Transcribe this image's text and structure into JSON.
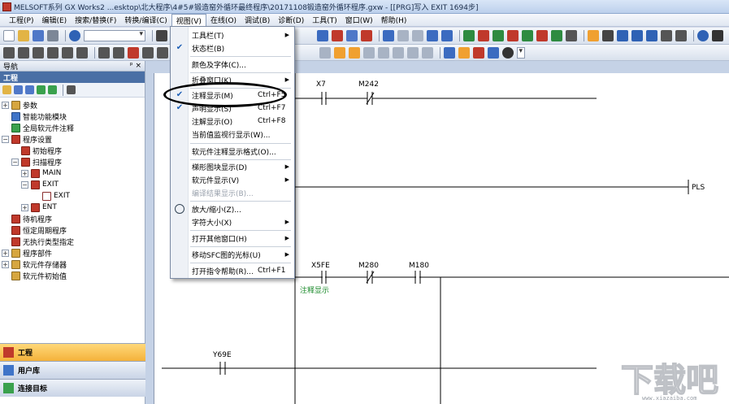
{
  "window": {
    "title": "MELSOFT系列 GX Works2 ...esktop\\北大程序\\4#5#锻造窑外循环最终程序\\20171108锻造窑外循环程序.gxw - [[PRG]写入 EXIT 1694步]"
  },
  "menubar": {
    "items": [
      {
        "label": "工程(P)"
      },
      {
        "label": "编辑(E)"
      },
      {
        "label": "搜索/替换(F)"
      },
      {
        "label": "转换/编译(C)"
      },
      {
        "label": "视图(V)"
      },
      {
        "label": "在线(O)"
      },
      {
        "label": "调试(B)"
      },
      {
        "label": "诊断(D)"
      },
      {
        "label": "工具(T)"
      },
      {
        "label": "窗口(W)"
      },
      {
        "label": "帮助(H)"
      }
    ]
  },
  "navigator": {
    "header": "导航",
    "pin": "ᵖ ×",
    "section": "工程",
    "tree": [
      {
        "label": "参数"
      },
      {
        "label": "智能功能模块"
      },
      {
        "label": "全局软元件注释"
      },
      {
        "label": "程序设置"
      },
      {
        "label": "初始程序"
      },
      {
        "label": "扫描程序"
      },
      {
        "label": "MAIN"
      },
      {
        "label": "EXIT"
      },
      {
        "label": "EXIT"
      },
      {
        "label": "ENT"
      },
      {
        "label": "待机程序"
      },
      {
        "label": "恒定周期程序"
      },
      {
        "label": "无执行类型指定"
      },
      {
        "label": "程序部件"
      },
      {
        "label": "软元件存储器"
      },
      {
        "label": "软元件初始值"
      }
    ],
    "bottom_tabs": [
      {
        "label": "工程"
      },
      {
        "label": "用户库"
      },
      {
        "label": "连接目标"
      }
    ]
  },
  "view_menu": {
    "items": [
      {
        "label": "工具栏(T)",
        "submenu": true
      },
      {
        "label": "状态栏(B)",
        "checked": true
      },
      {
        "label": "颜色及字体(C)..."
      },
      {
        "label": "折叠窗口(K)",
        "submenu": true
      },
      {
        "label": "注释显示(M)",
        "shortcut": "Ctrl+F5",
        "checked": true
      },
      {
        "label": "声明显示(S)",
        "shortcut": "Ctrl+F7",
        "checked": true
      },
      {
        "label": "注解显示(O)",
        "shortcut": "Ctrl+F8"
      },
      {
        "label": "当前值监视行显示(W)..."
      },
      {
        "label": "软元件注释显示格式(O)..."
      },
      {
        "label": "梯形图块显示(D)",
        "submenu": true
      },
      {
        "label": "软元件显示(V)",
        "submenu": true
      },
      {
        "label": "编译结果显示(B)...",
        "disabled": true
      },
      {
        "label": "放大/缩小(Z)..."
      },
      {
        "label": "字符大小(X)",
        "submenu": true
      },
      {
        "label": "打开其他窗口(H)",
        "submenu": true
      },
      {
        "label": "移动SFC图的光标(U)",
        "submenu": true
      },
      {
        "label": "打开指令帮助(R)...",
        "shortcut": "Ctrl+F1"
      }
    ],
    "arrow": "▶",
    "check": "✔"
  },
  "ladder": {
    "contacts": [
      {
        "label": "X7"
      },
      {
        "label": "M242"
      },
      {
        "label": "X5FE"
      },
      {
        "label": "M280"
      },
      {
        "label": "M180"
      },
      {
        "label": "Y69E"
      }
    ],
    "instruction": "PLS",
    "comment": "注释显示"
  },
  "watermark": {
    "text": "下载吧",
    "url": "www.xiazaiba.com"
  },
  "colors": {
    "accent": "#f4b23a",
    "comment_green": "#1a8a2a",
    "menu_highlight": "#1d5fb5"
  }
}
